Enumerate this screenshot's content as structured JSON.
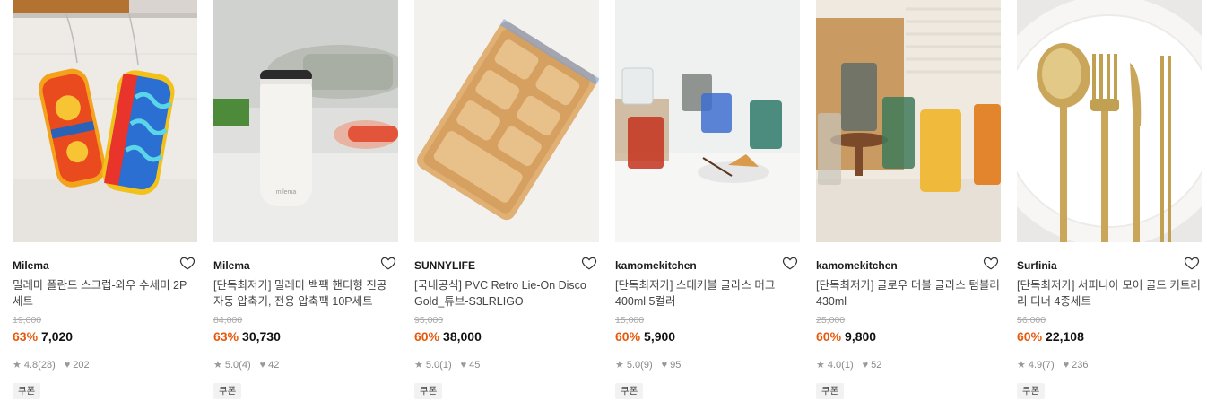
{
  "products": [
    {
      "brand": "Milema",
      "title": "밀레마 폴란드 스크럽-와우 수세미 2P 세트",
      "original_price": "19,000",
      "discount": "63%",
      "price": "7,020",
      "rating": "4.8",
      "reviews": "(28)",
      "likes": "202",
      "coupon": "쿠폰",
      "image": "scrub-sponges",
      "device_text": ""
    },
    {
      "brand": "Milema",
      "title": "[단독최저가] 밀레마 백팩 핸디형 진공 자동 압축기, 전용 압축팩 10P세트",
      "original_price": "84,000",
      "discount": "63%",
      "price": "30,730",
      "rating": "5.0",
      "reviews": "(4)",
      "likes": "42",
      "coupon": "쿠폰",
      "image": "vacuum-sealer",
      "device_text": "milema"
    },
    {
      "brand": "SUNNYLIFE",
      "title": "[국내공식] PVC Retro Lie-On Disco Gold_튜브-S3LRLIGO",
      "original_price": "95,000",
      "discount": "60%",
      "price": "38,000",
      "rating": "5.0",
      "reviews": "(1)",
      "likes": "45",
      "coupon": "쿠폰",
      "image": "inflatable-float",
      "device_text": ""
    },
    {
      "brand": "kamomekitchen",
      "title": "[단독최저가] 스태커블 글라스 머그 400ml 5컬러",
      "original_price": "15,000",
      "discount": "60%",
      "price": "5,900",
      "rating": "5.0",
      "reviews": "(9)",
      "likes": "95",
      "coupon": "쿠폰",
      "image": "glass-mugs",
      "device_text": ""
    },
    {
      "brand": "kamomekitchen",
      "title": "[단독최저가] 글로우 더블 글라스 텀블러 430ml",
      "original_price": "25,000",
      "discount": "60%",
      "price": "9,800",
      "rating": "4.0",
      "reviews": "(1)",
      "likes": "52",
      "coupon": "쿠폰",
      "image": "glass-tumblers",
      "device_text": ""
    },
    {
      "brand": "Surfinia",
      "title": "[단독최저가] 서피니아 모어 골드 커트러리 디너 4종세트",
      "original_price": "56,000",
      "discount": "60%",
      "price": "22,108",
      "rating": "4.9",
      "reviews": "(7)",
      "likes": "236",
      "coupon": "쿠폰",
      "image": "gold-cutlery",
      "device_text": ""
    }
  ]
}
